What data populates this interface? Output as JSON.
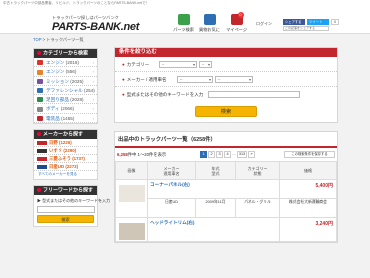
{
  "topbar": {
    "text": "中古トラックパーツ中部品業者、リビルド、トラックパーツのことならPARTS-BANK.netで！"
  },
  "header": {
    "tagline": "トラックパーツ探しはパーツバンク",
    "logo": "PARTS-BANK.net",
    "nav": [
      {
        "label": "パーツ検索",
        "color": "#3aa24a"
      },
      {
        "label": "買物お気に",
        "color": "#2e6fb3"
      },
      {
        "label": "マイページ",
        "color": "#c1272d",
        "badge": "0"
      }
    ],
    "login": "ログイン",
    "social": {
      "fb": "シェアする",
      "tw": "ツイート",
      "share": "この記事をシェアする",
      "count": "0"
    }
  },
  "breadcrumb": {
    "home": "TOP",
    "sep": " > ",
    "current": "トラックパーツ一覧"
  },
  "sidebar": {
    "category_title": "カテゴリーから検索",
    "categories": [
      {
        "label": "エンジン",
        "count": "(2016)",
        "color": "#d9342b"
      },
      {
        "label": "エンジン",
        "count": "(556)",
        "color": "#e5852b"
      },
      {
        "label": "ミッション",
        "count": "(2025)",
        "color": "#7a4fa2"
      },
      {
        "label": "デファレンシャル",
        "count": "(254)",
        "color": "#2e6fb3"
      },
      {
        "label": "足回り部品",
        "count": "(2028)",
        "color": "#2a8d4a"
      },
      {
        "label": "ボディ",
        "count": "(2066)",
        "color": "#888888"
      },
      {
        "label": "電装品",
        "count": "(1455)",
        "color": "#c1272d"
      }
    ],
    "maker_title": "メーカーから探す",
    "makers": [
      {
        "label": "日野",
        "count": "(1226)",
        "color": "#c1272d"
      },
      {
        "label": "いすゞ",
        "count": "(2290)",
        "color": "#333333"
      },
      {
        "label": "三菱ふそう",
        "count": "(1737)",
        "color": "#c1272d"
      },
      {
        "label": "日産UD",
        "count": "(2273)",
        "color": "#1f4a8c"
      }
    ],
    "makers_more": "すべてのメーカーを見る",
    "freeword_title": "フリーワードから探す",
    "freeword_label": "▶ 型式またはその他のキーワードを入力",
    "freeword_button": "検索"
  },
  "search": {
    "title": "条件を絞り込む",
    "rows": [
      {
        "label": "カテゴリー",
        "select1": "--",
        "select2": "--"
      },
      {
        "label": "メーカー / 適用車名",
        "select1": "--",
        "select2": "--"
      },
      {
        "label": "型式またはその他のキーワードを入力",
        "select1": "",
        "select2": ""
      }
    ],
    "button": "検索"
  },
  "listing": {
    "title": "出品中のトラックパーツ一覧（6258件）",
    "count_prefix": "6,258",
    "count_suffix": "件中 1～20件を表示",
    "pages": [
      "1",
      "2",
      "3",
      "4",
      "…",
      "313",
      "»"
    ],
    "print_button": "この検索条件を保存する",
    "columns": [
      "画像",
      "メーカー\n適用車名",
      "年式\n型式",
      "カテゴリー\n状態",
      "価格"
    ],
    "rows": [
      {
        "title": "コーナーパネル(右)",
        "price": "5,400円",
        "year": "2009年11月",
        "model": "KL-FD1JTZ",
        "maker": "日産UD",
        "type": "パネル・グリル",
        "state": "中古",
        "shop": "株式会社大新運輸商会"
      },
      {
        "title": "ヘッドライトリム(右)",
        "price": "3,240円",
        "year": "",
        "model": "",
        "maker": "",
        "type": "",
        "state": "",
        "shop": ""
      }
    ]
  }
}
